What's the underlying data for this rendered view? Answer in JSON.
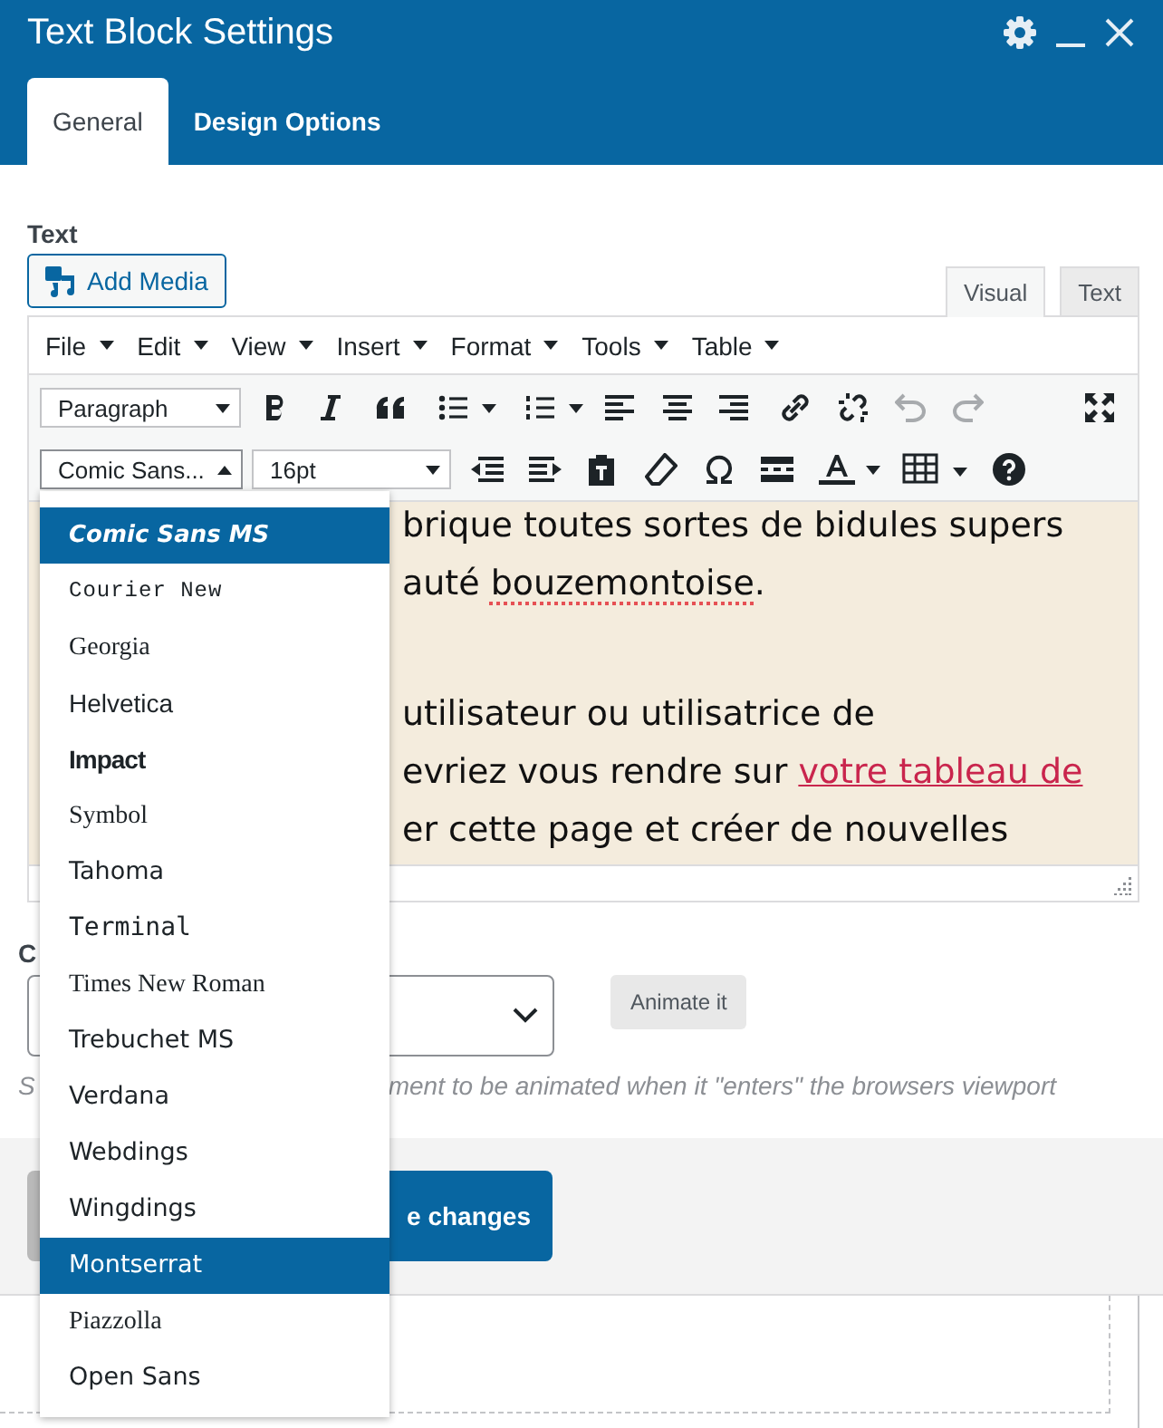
{
  "window": {
    "title": "Text Block Settings"
  },
  "header_tabs": [
    {
      "label": "General",
      "selected": true
    },
    {
      "label": "Design Options",
      "selected": false
    }
  ],
  "text_field": {
    "label": "Text",
    "add_media": "Add Media",
    "mode_tabs": [
      {
        "label": "Visual",
        "selected": true
      },
      {
        "label": "Text",
        "selected": false
      }
    ],
    "menus": [
      "File",
      "Edit",
      "View",
      "Insert",
      "Format",
      "Tools",
      "Table"
    ],
    "block_format": "Paragraph",
    "font_family": "Comic Sans...",
    "font_size": "16pt",
    "paragraphs": [
      {
        "lines": [
          {
            "segments": [
              {
                "text": "brique toutes sortes de bidules supers"
              }
            ]
          },
          {
            "segments": [
              {
                "text": "auté "
              },
              {
                "text": "bouzemontoise",
                "kind": "misspelled"
              },
              {
                "text": "."
              }
            ]
          }
        ]
      },
      {
        "lines": [
          {
            "segments": [
              {
                "text": "utilisateur ou utilisatrice de"
              }
            ]
          },
          {
            "segments": [
              {
                "text": "evriez vous rendre sur "
              },
              {
                "text": "votre tableau de",
                "kind": "link"
              }
            ]
          },
          {
            "segments": [
              {
                "text": "er cette page et créer de nouvelles"
              }
            ]
          }
        ]
      }
    ]
  },
  "font_menu": {
    "items": [
      {
        "label": "Comic Sans MS",
        "kind": "comic",
        "highlighted": true
      },
      {
        "label": "Courier New",
        "kind": "mono",
        "highlighted": false
      },
      {
        "label": "Georgia",
        "kind": "serif",
        "highlighted": false
      },
      {
        "label": "Helvetica",
        "kind": "sans",
        "highlighted": false
      },
      {
        "label": "Impact",
        "kind": "impact",
        "highlighted": false
      },
      {
        "label": "Symbol",
        "kind": "serif",
        "highlighted": false
      },
      {
        "label": "Tahoma",
        "kind": "wide",
        "highlighted": false
      },
      {
        "label": "Terminal",
        "kind": "terminal",
        "highlighted": false
      },
      {
        "label": "Times New Roman",
        "kind": "serif",
        "highlighted": false
      },
      {
        "label": "Trebuchet MS",
        "kind": "wide",
        "highlighted": false
      },
      {
        "label": "Verdana",
        "kind": "wide",
        "highlighted": false
      },
      {
        "label": "Webdings",
        "kind": "wide",
        "highlighted": false
      },
      {
        "label": "Wingdings",
        "kind": "wide",
        "highlighted": false
      },
      {
        "label": "Montserrat",
        "kind": "wide",
        "highlighted": true
      },
      {
        "label": "Piazzolla",
        "kind": "serif",
        "highlighted": false
      },
      {
        "label": "Open Sans",
        "kind": "wide",
        "highlighted": false
      }
    ]
  },
  "animation": {
    "label": "C",
    "animate_button": "Animate it",
    "help_start": "S",
    "help_end": "ment to be animated when it \"enters\" the browsers viewport"
  },
  "footer": {
    "save_button": "e changes"
  }
}
